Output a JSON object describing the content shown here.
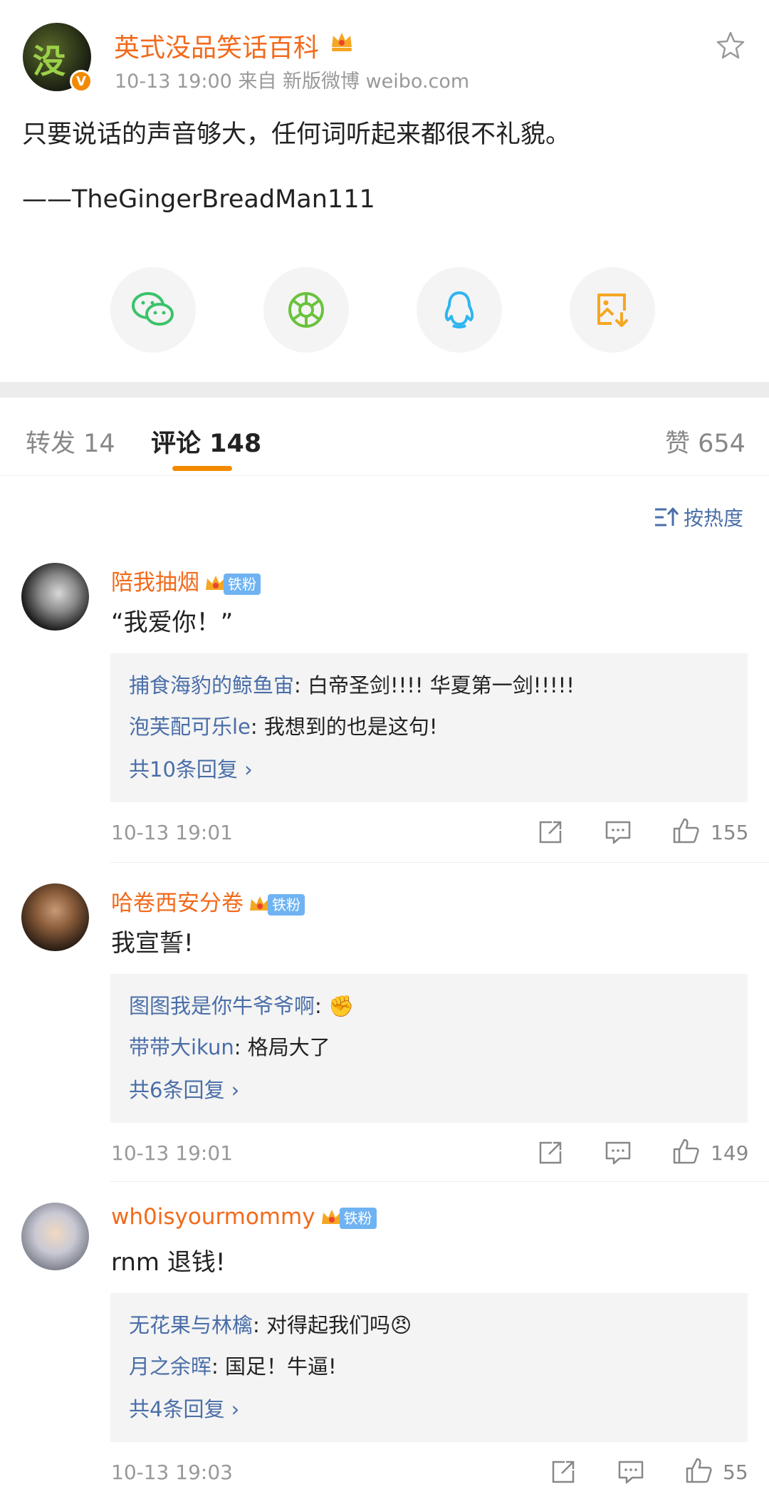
{
  "post": {
    "author": "英式没品笑话百科",
    "meta": "10-13 19:00  来自 新版微博 weibo.com",
    "text": "只要说话的声音够大，任何词听起来都很不礼貌。",
    "source_line": "——TheGingerBreadMan111",
    "avatar_glyph": "没",
    "verified_badge": "V"
  },
  "share_icons": [
    "wechat-icon",
    "moments-icon",
    "qq-icon",
    "save-image-icon"
  ],
  "tabs": {
    "repost": "转发 14",
    "comments": "评论 148",
    "likes": "赞 654"
  },
  "sort_label": "按热度",
  "fan_tag": "铁粉",
  "comments": [
    {
      "name": "陪我抽烟",
      "text": "“我爱你！”",
      "replies": [
        {
          "name": "捕食海豹的鲸鱼宙",
          "text": ": 白帝圣剑!!!!  华夏第一剑!!!!!"
        },
        {
          "name": "泡芙配可乐le",
          "text": ": 我想到的也是这句!"
        }
      ],
      "more": "共10条回复",
      "time": "10-13 19:01",
      "likes": "155"
    },
    {
      "name": "哈卷西安分卷",
      "text": "我宣誓!",
      "replies": [
        {
          "name": "图图我是你牛爷爷啊",
          "text": ": ✊"
        },
        {
          "name": "带带大ikun",
          "text": ": 格局大了"
        }
      ],
      "more": "共6条回复",
      "time": "10-13 19:01",
      "likes": "149"
    },
    {
      "name": "wh0isyourmommy",
      "text": "rnm 退钱!",
      "replies": [
        {
          "name": "无花果与林檎",
          "text": ": 对得起我们吗😠"
        },
        {
          "name": "月之余晖",
          "text": ": 国足！牛逼!"
        }
      ],
      "more": "共4条回复",
      "time": "10-13 19:03",
      "likes": "55"
    }
  ],
  "colors": {
    "accent_orange": "#f26a1b",
    "link_blue": "#4a6ea8",
    "tab_indicator": "#f28a00"
  }
}
